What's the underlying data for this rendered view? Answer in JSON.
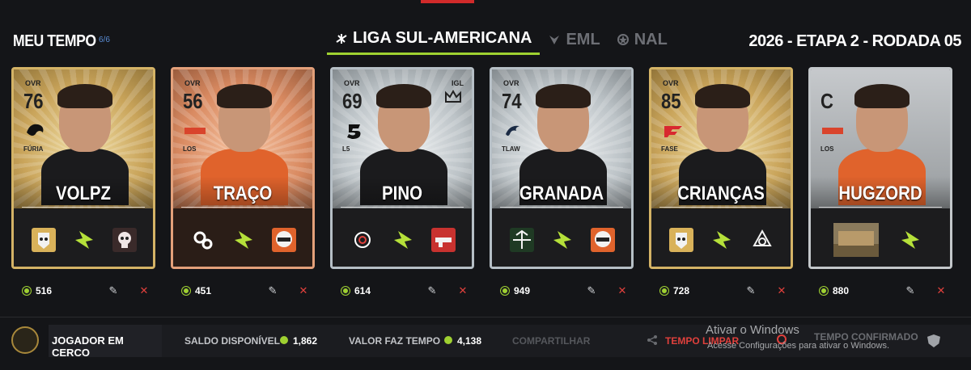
{
  "header": {
    "team_title": "MEU TEMPO",
    "team_count": "6/6",
    "leagues": [
      {
        "label": "LIGA SUL-AMERICANA",
        "active": true
      },
      {
        "label": "EML",
        "active": false
      },
      {
        "label": "NAL",
        "active": false
      }
    ],
    "round": "2026 - ETAPA 2 - RODADA 05"
  },
  "cards": [
    {
      "ovr_label": "OVR",
      "ovr": "76",
      "team": "FÚRIA",
      "role": "",
      "name": "VOLPZ",
      "tier": "gold",
      "price": "516",
      "ops": [
        "operator-mask-icon",
        "lightning-icon",
        "skull-icon"
      ]
    },
    {
      "ovr_label": "OVR",
      "ovr": "56",
      "team": "LOS",
      "role": "",
      "name": "TRAÇO",
      "tier": "bronze",
      "price": "451",
      "ops": [
        "gears-icon",
        "lightning-icon",
        "helmet-icon"
      ]
    },
    {
      "ovr_label": "OVR",
      "ovr": "69",
      "team": "L5",
      "role": "IGL",
      "name": "PINO",
      "tier": "silver",
      "price": "614",
      "ops": [
        "spiral-icon",
        "lightning-icon",
        "gun-icon"
      ]
    },
    {
      "ovr_label": "OVR",
      "ovr": "74",
      "team": "TLAW",
      "role": "",
      "name": "GRANADA",
      "tier": "silver",
      "price": "949",
      "ops": [
        "bow-icon",
        "lightning-icon",
        "helmet-icon"
      ]
    },
    {
      "ovr_label": "OVR",
      "ovr": "85",
      "team": "FASE",
      "role": "",
      "name": "CRIANÇAS",
      "tier": "gold",
      "price": "728",
      "ops": [
        "operator-mask-icon",
        "lightning-icon",
        "knot-icon"
      ]
    },
    {
      "ovr_label": "",
      "ovr": "C",
      "team": "LOS",
      "role": "",
      "name": "HUGZORD",
      "tier": "coach",
      "price": "880",
      "ops": [
        "map-thumbnail",
        "lightning-icon"
      ]
    }
  ],
  "footer": {
    "label": "JOGADOR EM CERCO",
    "saldo_label": "SALDO DISPONÍVEL",
    "saldo_value": "1,862",
    "valor_label": "VALOR FAZ TEMPO",
    "valor_value": "4,138",
    "share": "COMPARTILHAR",
    "clear": "TEMPO LIMPAR",
    "confirm": "TEMPO CONFIRMADO"
  },
  "watermark": {
    "title": "Ativar o Windows",
    "subtitle": "Acesse Configurações para ativar o Windows."
  },
  "colors": {
    "accent": "#9fd131",
    "danger": "#e0403c",
    "bg": "#141518"
  }
}
